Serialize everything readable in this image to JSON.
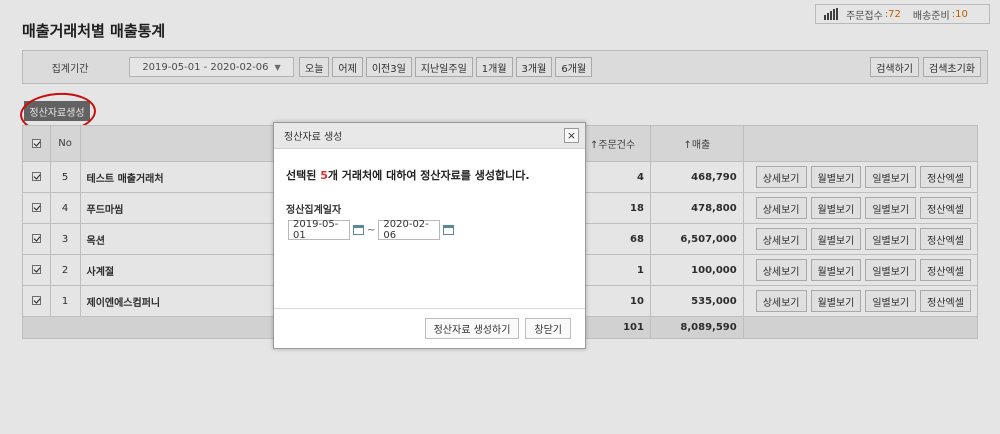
{
  "status": {
    "order_label": "주문접수",
    "order_count": ":72",
    "shipping_label": "배송준비",
    "shipping_count": ":10"
  },
  "page_title": "매출거래처별 매출통계",
  "filter": {
    "label": "집계기간",
    "date_range": "2019-05-01 - 2020-02-06",
    "periods": [
      "오늘",
      "어제",
      "이전3일",
      "지난일주일",
      "1개월",
      "3개월",
      "6개월"
    ],
    "search_label": "검색하기",
    "reset_label": "검색초기화"
  },
  "make_button_label": "정산자료생성",
  "table": {
    "headers": {
      "no": "No",
      "order_count": "↑주문건수",
      "sales": "↑매출"
    },
    "rows": [
      {
        "no": "5",
        "name": "테스트 매출거래처",
        "count": "4",
        "sales": "468,790"
      },
      {
        "no": "4",
        "name": "푸드마씸",
        "count": "18",
        "sales": "478,800"
      },
      {
        "no": "3",
        "name": "옥션",
        "count": "68",
        "sales": "6,507,000"
      },
      {
        "no": "2",
        "name": "사계절",
        "count": "1",
        "sales": "100,000"
      },
      {
        "no": "1",
        "name": "제이엔에스컴퍼니",
        "count": "10",
        "sales": "535,000"
      }
    ],
    "actions": [
      "상세보기",
      "월별보기",
      "일별보기",
      "정산엑셀"
    ],
    "total_count": "101",
    "total_sales": "8,089,590"
  },
  "modal": {
    "title": "정산자료 생성",
    "close": "×",
    "msg_prefix": "선택된 ",
    "msg_count": "5",
    "msg_suffix": "개 거래처에 대하여 정산자료를 생성합니다.",
    "date_label": "정산집계일자",
    "date_from": "2019-05-01",
    "tilde": "~",
    "date_to": "2020-02-06",
    "create_label": "정산자료 생성하기",
    "close_label": "창닫기"
  }
}
